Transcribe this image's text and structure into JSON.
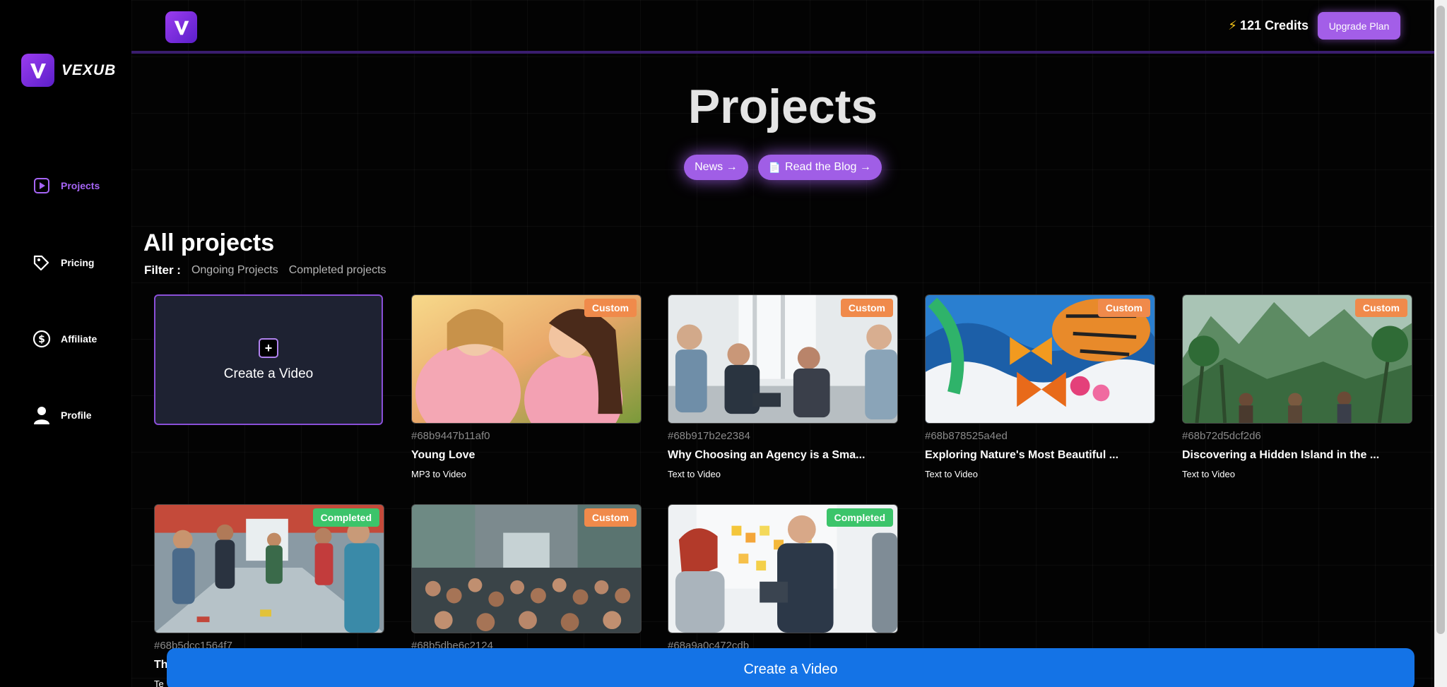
{
  "brand": {
    "name": "VEXUB"
  },
  "sidebar": {
    "items": [
      {
        "label": "Projects",
        "icon": "play-square-icon",
        "active": true
      },
      {
        "label": "Pricing",
        "icon": "tag-icon",
        "active": false
      },
      {
        "label": "Affiliate",
        "icon": "dollar-circle-icon",
        "active": false
      },
      {
        "label": "Profile",
        "icon": "user-icon",
        "active": false
      }
    ]
  },
  "header": {
    "credits": "121 Credits",
    "upgrade_label": "Upgrade Plan"
  },
  "hero": {
    "title": "Projects",
    "news_label": "News →",
    "blog_label": "Read the Blog →"
  },
  "projects": {
    "section_title": "All projects",
    "filter_label": "Filter :",
    "filter_options": [
      "Ongoing Projects",
      "Completed projects"
    ],
    "create_label": "Create a Video",
    "items": [
      {
        "id": "#68b9447b11af0",
        "title": "Young Love",
        "type": "MP3 to Video",
        "badge": "Custom"
      },
      {
        "id": "#68b917b2e2384",
        "title": "Why Choosing an Agency is a Sma...",
        "type": "Text to Video",
        "badge": "Custom"
      },
      {
        "id": "#68b878525a4ed",
        "title": "Exploring Nature's Most Beautiful ...",
        "type": "Text to Video",
        "badge": "Custom"
      },
      {
        "id": "#68b72d5dcf2d6",
        "title": "Discovering a Hidden Island in the ...",
        "type": "Text to Video",
        "badge": "Custom"
      },
      {
        "id": "#68b5dcc1564f7",
        "title": "Th",
        "type": "Te",
        "badge": "Completed"
      },
      {
        "id": "#68b5dbe6c2124",
        "title": "",
        "type": "",
        "badge": "Custom"
      },
      {
        "id": "#68a9a0c472cdb",
        "title": "",
        "type": "",
        "badge": "Completed"
      }
    ]
  },
  "bottom": {
    "create_label": "Create a Video"
  },
  "colors": {
    "accent": "#a35ee8",
    "custom_badge": "#f08a4b",
    "completed_badge": "#3cc46a",
    "primary_button": "#1473e6"
  }
}
